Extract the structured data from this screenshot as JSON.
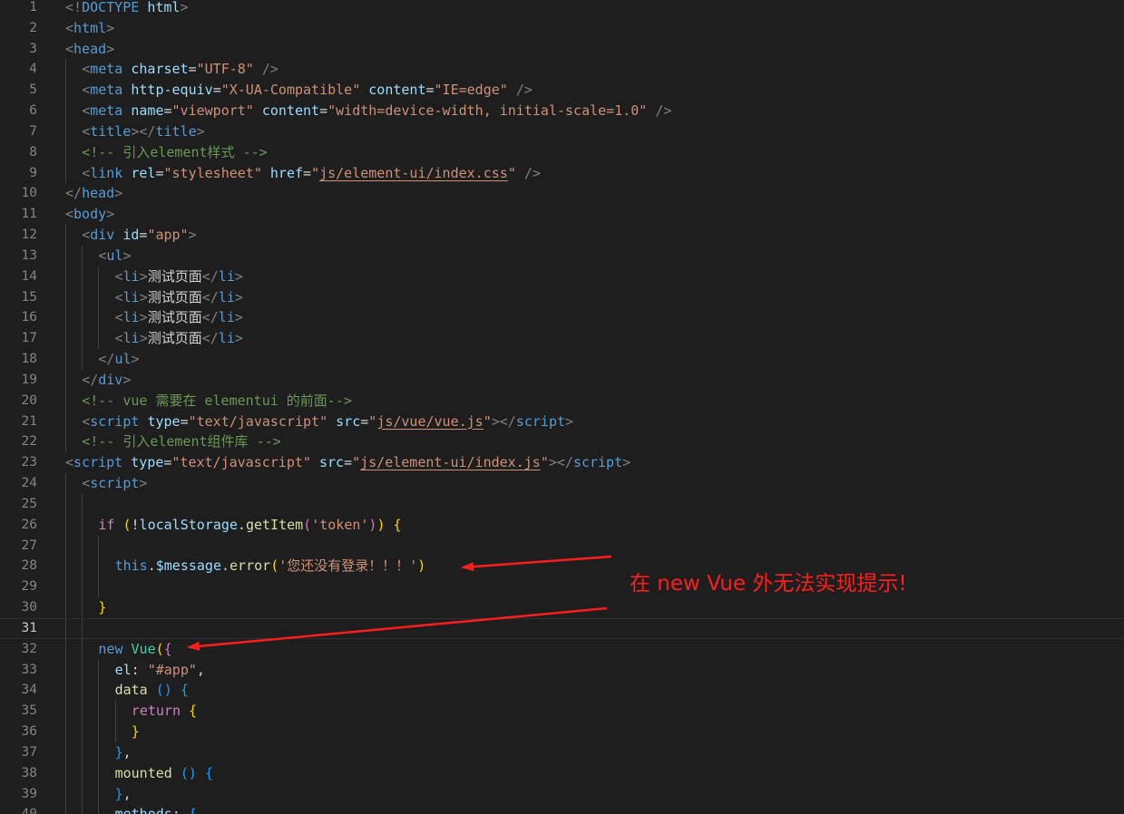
{
  "editor": {
    "lines": [
      {
        "n": "1",
        "indent": 0,
        "tokens": [
          [
            "br",
            "<!"
          ],
          [
            "tag",
            "DOCTYPE"
          ],
          [
            "text",
            " "
          ],
          [
            "attr",
            "html"
          ],
          [
            "br",
            ">"
          ]
        ]
      },
      {
        "n": "2",
        "indent": 0,
        "tokens": [
          [
            "br",
            "<"
          ],
          [
            "tag",
            "html"
          ],
          [
            "br",
            ">"
          ]
        ]
      },
      {
        "n": "3",
        "indent": 0,
        "tokens": [
          [
            "br",
            "<"
          ],
          [
            "tag",
            "head"
          ],
          [
            "br",
            ">"
          ]
        ]
      },
      {
        "n": "4",
        "indent": 1,
        "tokens": [
          [
            "br",
            "<"
          ],
          [
            "tag",
            "meta"
          ],
          [
            "text",
            " "
          ],
          [
            "attr",
            "charset"
          ],
          [
            "text",
            "="
          ],
          [
            "str",
            "\"UTF-8\""
          ],
          [
            "text",
            " "
          ],
          [
            "br",
            "/>"
          ]
        ]
      },
      {
        "n": "5",
        "indent": 1,
        "tokens": [
          [
            "br",
            "<"
          ],
          [
            "tag",
            "meta"
          ],
          [
            "text",
            " "
          ],
          [
            "attr",
            "http-equiv"
          ],
          [
            "text",
            "="
          ],
          [
            "str",
            "\"X-UA-Compatible\""
          ],
          [
            "text",
            " "
          ],
          [
            "attr",
            "content"
          ],
          [
            "text",
            "="
          ],
          [
            "str",
            "\"IE=edge\""
          ],
          [
            "text",
            " "
          ],
          [
            "br",
            "/>"
          ]
        ]
      },
      {
        "n": "6",
        "indent": 1,
        "tokens": [
          [
            "br",
            "<"
          ],
          [
            "tag",
            "meta"
          ],
          [
            "text",
            " "
          ],
          [
            "attr",
            "name"
          ],
          [
            "text",
            "="
          ],
          [
            "str",
            "\"viewport\""
          ],
          [
            "text",
            " "
          ],
          [
            "attr",
            "content"
          ],
          [
            "text",
            "="
          ],
          [
            "str",
            "\"width=device-width, initial-scale=1.0\""
          ],
          [
            "text",
            " "
          ],
          [
            "br",
            "/>"
          ]
        ]
      },
      {
        "n": "7",
        "indent": 1,
        "tokens": [
          [
            "br",
            "<"
          ],
          [
            "tag",
            "title"
          ],
          [
            "br",
            "></"
          ],
          [
            "tag",
            "title"
          ],
          [
            "br",
            ">"
          ]
        ]
      },
      {
        "n": "8",
        "indent": 1,
        "tokens": [
          [
            "com",
            "<!-- 引入element样式 -->"
          ]
        ]
      },
      {
        "n": "9",
        "indent": 1,
        "tokens": [
          [
            "br",
            "<"
          ],
          [
            "tag",
            "link"
          ],
          [
            "text",
            " "
          ],
          [
            "attr",
            "rel"
          ],
          [
            "text",
            "="
          ],
          [
            "str",
            "\"stylesheet\""
          ],
          [
            "text",
            " "
          ],
          [
            "attr",
            "href"
          ],
          [
            "text",
            "="
          ],
          [
            "str",
            "\""
          ],
          [
            "url",
            "js/element-ui/index.css"
          ],
          [
            "str",
            "\""
          ],
          [
            "text",
            " "
          ],
          [
            "br",
            "/>"
          ]
        ]
      },
      {
        "n": "10",
        "indent": 0,
        "tokens": [
          [
            "br",
            "</"
          ],
          [
            "tag",
            "head"
          ],
          [
            "br",
            ">"
          ]
        ]
      },
      {
        "n": "11",
        "indent": 0,
        "tokens": [
          [
            "br",
            "<"
          ],
          [
            "tag",
            "body"
          ],
          [
            "br",
            ">"
          ]
        ]
      },
      {
        "n": "12",
        "indent": 1,
        "tokens": [
          [
            "br",
            "<"
          ],
          [
            "tag",
            "div"
          ],
          [
            "text",
            " "
          ],
          [
            "attr",
            "id"
          ],
          [
            "text",
            "="
          ],
          [
            "str",
            "\"app\""
          ],
          [
            "br",
            ">"
          ]
        ]
      },
      {
        "n": "13",
        "indent": 2,
        "tokens": [
          [
            "br",
            "<"
          ],
          [
            "tag",
            "ul"
          ],
          [
            "br",
            ">"
          ]
        ]
      },
      {
        "n": "14",
        "indent": 3,
        "tokens": [
          [
            "br",
            "<"
          ],
          [
            "tag",
            "li"
          ],
          [
            "br",
            ">"
          ],
          [
            "text",
            "测试页面"
          ],
          [
            "br",
            "</"
          ],
          [
            "tag",
            "li"
          ],
          [
            "br",
            ">"
          ]
        ]
      },
      {
        "n": "15",
        "indent": 3,
        "tokens": [
          [
            "br",
            "<"
          ],
          [
            "tag",
            "li"
          ],
          [
            "br",
            ">"
          ],
          [
            "text",
            "测试页面"
          ],
          [
            "br",
            "</"
          ],
          [
            "tag",
            "li"
          ],
          [
            "br",
            ">"
          ]
        ]
      },
      {
        "n": "16",
        "indent": 3,
        "tokens": [
          [
            "br",
            "<"
          ],
          [
            "tag",
            "li"
          ],
          [
            "br",
            ">"
          ],
          [
            "text",
            "测试页面"
          ],
          [
            "br",
            "</"
          ],
          [
            "tag",
            "li"
          ],
          [
            "br",
            ">"
          ]
        ]
      },
      {
        "n": "17",
        "indent": 3,
        "tokens": [
          [
            "br",
            "<"
          ],
          [
            "tag",
            "li"
          ],
          [
            "br",
            ">"
          ],
          [
            "text",
            "测试页面"
          ],
          [
            "br",
            "</"
          ],
          [
            "tag",
            "li"
          ],
          [
            "br",
            ">"
          ]
        ]
      },
      {
        "n": "18",
        "indent": 2,
        "tokens": [
          [
            "br",
            "</"
          ],
          [
            "tag",
            "ul"
          ],
          [
            "br",
            ">"
          ]
        ]
      },
      {
        "n": "19",
        "indent": 1,
        "tokens": [
          [
            "br",
            "</"
          ],
          [
            "tag",
            "div"
          ],
          [
            "br",
            ">"
          ]
        ]
      },
      {
        "n": "20",
        "indent": 1,
        "tokens": [
          [
            "com",
            "<!-- vue 需要在 elementui 的前面-->"
          ]
        ]
      },
      {
        "n": "21",
        "indent": 1,
        "tokens": [
          [
            "br",
            "<"
          ],
          [
            "tag",
            "script"
          ],
          [
            "text",
            " "
          ],
          [
            "attr",
            "type"
          ],
          [
            "text",
            "="
          ],
          [
            "str",
            "\"text/javascript\""
          ],
          [
            "text",
            " "
          ],
          [
            "attr",
            "src"
          ],
          [
            "text",
            "="
          ],
          [
            "str",
            "\""
          ],
          [
            "url",
            "js/vue/vue.js"
          ],
          [
            "str",
            "\""
          ],
          [
            "br",
            "></"
          ],
          [
            "tag",
            "script"
          ],
          [
            "br",
            ">"
          ]
        ]
      },
      {
        "n": "22",
        "indent": 1,
        "tokens": [
          [
            "com",
            "<!-- 引入element组件库 -->"
          ]
        ]
      },
      {
        "n": "23",
        "indent": 0,
        "tokens": [
          [
            "br",
            "<"
          ],
          [
            "tag",
            "script"
          ],
          [
            "text",
            " "
          ],
          [
            "attr",
            "type"
          ],
          [
            "text",
            "="
          ],
          [
            "str",
            "\"text/javascript\""
          ],
          [
            "text",
            " "
          ],
          [
            "attr",
            "src"
          ],
          [
            "text",
            "="
          ],
          [
            "str",
            "\""
          ],
          [
            "url",
            "js/element-ui/index.js"
          ],
          [
            "str",
            "\""
          ],
          [
            "br",
            "></"
          ],
          [
            "tag",
            "script"
          ],
          [
            "br",
            ">"
          ]
        ]
      },
      {
        "n": "24",
        "indent": 1,
        "tokens": [
          [
            "br",
            "<"
          ],
          [
            "tag",
            "script"
          ],
          [
            "br",
            ">"
          ]
        ]
      },
      {
        "n": "25",
        "indent": 0,
        "tokens": []
      },
      {
        "n": "26",
        "indent": 2,
        "tokens": [
          [
            "kw",
            "if"
          ],
          [
            "text",
            " "
          ],
          [
            "p1",
            "("
          ],
          [
            "text",
            "!"
          ],
          [
            "var",
            "localStorage"
          ],
          [
            "text",
            "."
          ],
          [
            "fn",
            "getItem"
          ],
          [
            "p2",
            "("
          ],
          [
            "str",
            "'token'"
          ],
          [
            "p2",
            ")"
          ],
          [
            "p1",
            ")"
          ],
          [
            "text",
            " "
          ],
          [
            "p1",
            "{"
          ]
        ]
      },
      {
        "n": "27",
        "indent": 0,
        "tokens": []
      },
      {
        "n": "28",
        "indent": 3,
        "tokens": [
          [
            "kw2",
            "this"
          ],
          [
            "text",
            "."
          ],
          [
            "var",
            "$message"
          ],
          [
            "text",
            "."
          ],
          [
            "fn",
            "error"
          ],
          [
            "p1",
            "("
          ],
          [
            "str",
            "'您还没有登录！！！'"
          ],
          [
            "p1",
            ")"
          ]
        ]
      },
      {
        "n": "29",
        "indent": 0,
        "tokens": []
      },
      {
        "n": "30",
        "indent": 2,
        "tokens": [
          [
            "p1",
            "}"
          ]
        ]
      },
      {
        "n": "31",
        "indent": 0,
        "tokens": [],
        "current": true
      },
      {
        "n": "32",
        "indent": 2,
        "tokens": [
          [
            "kw2",
            "new"
          ],
          [
            "text",
            " "
          ],
          [
            "cls",
            "Vue"
          ],
          [
            "p1",
            "("
          ],
          [
            "p2",
            "{"
          ]
        ]
      },
      {
        "n": "33",
        "indent": 3,
        "tokens": [
          [
            "var",
            "el"
          ],
          [
            "text",
            ": "
          ],
          [
            "str",
            "\"#app\""
          ],
          [
            "text",
            ","
          ]
        ]
      },
      {
        "n": "34",
        "indent": 3,
        "tokens": [
          [
            "fn",
            "data"
          ],
          [
            "text",
            " "
          ],
          [
            "p3",
            "()"
          ],
          [
            "text",
            " "
          ],
          [
            "p3",
            "{"
          ]
        ]
      },
      {
        "n": "35",
        "indent": 4,
        "tokens": [
          [
            "kw",
            "return"
          ],
          [
            "text",
            " "
          ],
          [
            "p1",
            "{"
          ]
        ]
      },
      {
        "n": "36",
        "indent": 4,
        "tokens": [
          [
            "p1",
            "}"
          ]
        ]
      },
      {
        "n": "37",
        "indent": 3,
        "tokens": [
          [
            "p3",
            "}"
          ],
          [
            "text",
            ","
          ]
        ]
      },
      {
        "n": "38",
        "indent": 3,
        "tokens": [
          [
            "fn",
            "mounted"
          ],
          [
            "text",
            " "
          ],
          [
            "p3",
            "()"
          ],
          [
            "text",
            " "
          ],
          [
            "p3",
            "{"
          ]
        ]
      },
      {
        "n": "39",
        "indent": 3,
        "tokens": [
          [
            "p3",
            "}"
          ],
          [
            "text",
            ","
          ]
        ]
      },
      {
        "n": "40",
        "indent": 3,
        "tokens": [
          [
            "var",
            "methods"
          ],
          [
            "text",
            ": "
          ],
          [
            "p3",
            "{"
          ]
        ]
      }
    ]
  },
  "annotation": {
    "text": "在 new Vue 外无法实现提示!",
    "color": "#ff1e1e"
  },
  "theme": {
    "background": "#1e1e1e",
    "line_number": "#858585",
    "indent_guide": "#404040"
  }
}
